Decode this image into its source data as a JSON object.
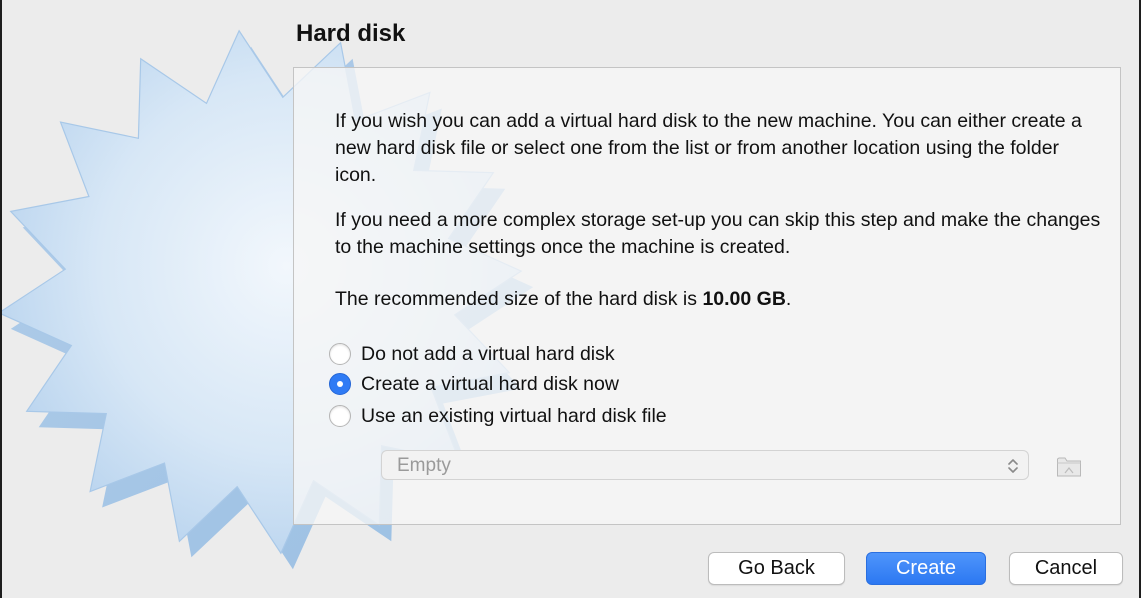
{
  "wizard": {
    "title": "Hard disk",
    "paragraph1": "If you wish you can add a virtual hard disk to the new machine. You can either create a new hard disk file or select one from the list or from another location using the folder icon.",
    "paragraph2": "If you need a more complex storage set-up you can skip this step and make the changes to the machine settings once the machine is created.",
    "recommended_prefix": "The recommended size of the hard disk is ",
    "recommended_size": "10.00 GB",
    "recommended_suffix": "."
  },
  "options": {
    "no_disk": {
      "label": "Do not add a virtual hard disk",
      "checked": false
    },
    "create_now": {
      "label": "Create a virtual hard disk now",
      "checked": true
    },
    "use_existing": {
      "label": "Use an existing virtual hard disk file",
      "checked": false
    }
  },
  "disk_select": {
    "value": "Empty",
    "enabled": false
  },
  "buttons": {
    "back": "Go Back",
    "create": "Create",
    "cancel": "Cancel"
  },
  "colors": {
    "accent": "#2f7bf5",
    "window_bg": "#ececec",
    "starburst": "#c9def3"
  },
  "icons": [
    "starburst-watermark",
    "chevron-updown-icon",
    "folder-icon"
  ]
}
